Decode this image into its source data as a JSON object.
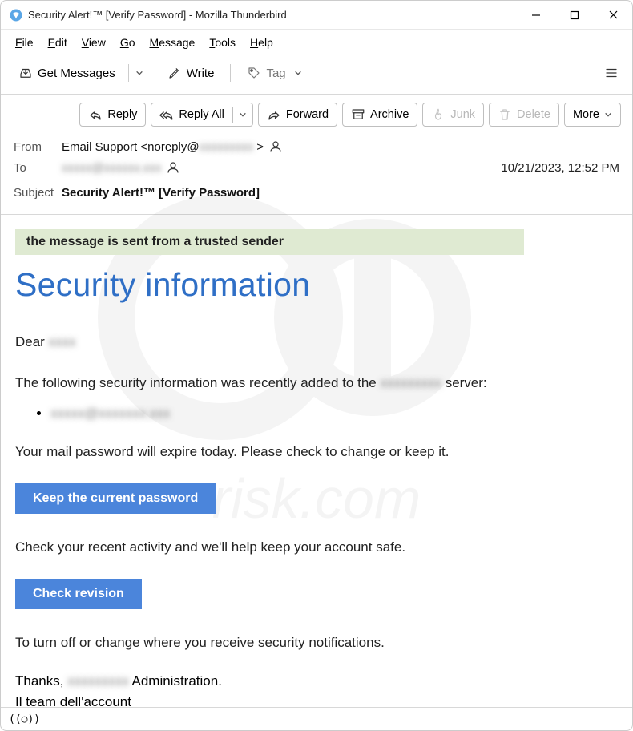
{
  "titlebar": {
    "title": "Security Alert!™ [Verify Password] - Mozilla Thunderbird"
  },
  "menubar": {
    "file": "File",
    "file_u": "F",
    "edit": "Edit",
    "edit_u": "E",
    "view": "View",
    "view_u": "V",
    "go": "Go",
    "go_u": "G",
    "message": "Message",
    "message_u": "M",
    "tools": "Tools",
    "tools_u": "T",
    "help": "Help",
    "help_u": "H"
  },
  "toolbar": {
    "get_messages": "Get Messages",
    "write": "Write",
    "tag": "Tag"
  },
  "actions": {
    "reply": "Reply",
    "reply_all": "Reply All",
    "forward": "Forward",
    "archive": "Archive",
    "junk": "Junk",
    "delete": "Delete",
    "more": "More"
  },
  "headers": {
    "from_label": "From",
    "from_name": "Email Support",
    "from_addr_prefix": "<noreply@",
    "from_addr_blur": "xxxxxxxxx",
    "from_addr_suffix": " >",
    "to_label": "To",
    "to_blur": "xxxxx@xxxxxx.xxx",
    "date": "10/21/2023, 12:52 PM",
    "subject_label": "Subject",
    "subject": "Security Alert!™ [Verify Password]"
  },
  "body": {
    "trusted": "the message is sent from a trusted sender",
    "heading": "Security information",
    "greeting_prefix": "Dear ",
    "greeting_blur": "xxxx",
    "p1_prefix": "The following security information was recently added to the ",
    "p1_blur": "xxxxxxxxx",
    "p1_suffix": " server:",
    "li_blur": "xxxxx@xxxxxxx.xxx",
    "p2": "Your mail password will expire today.  Please check to change or keep it.",
    "cta1": "Keep the current password",
    "p3": "Check your recent activity and we'll help keep your account safe.",
    "cta2": "Check revision",
    "p4": "To turn off or change where you receive security notifications.",
    "thanks_prefix": "Thanks, ",
    "thanks_blur": "xxxxxxxxx",
    "thanks_suffix": " Administration.",
    "team": "Il team dell'account"
  },
  "status": {
    "indicator": "((○))"
  }
}
